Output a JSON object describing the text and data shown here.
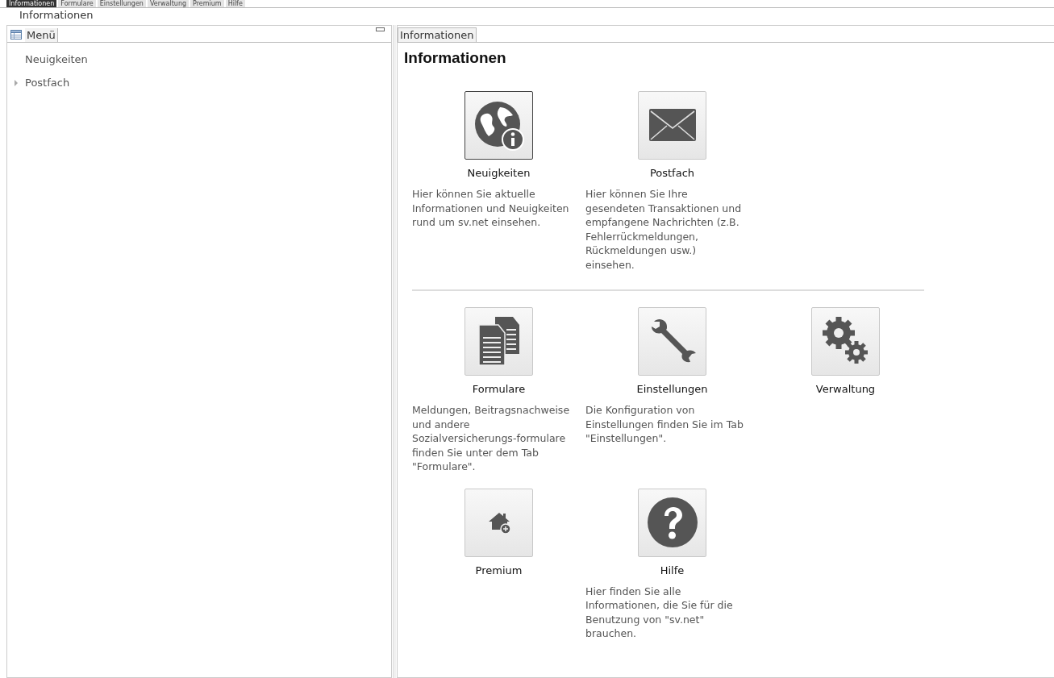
{
  "top_tabs": [
    {
      "label": "Informationen",
      "selected": true
    },
    {
      "label": "Formulare",
      "selected": false
    },
    {
      "label": "Einstellungen",
      "selected": false
    },
    {
      "label": "Verwaltung",
      "selected": false
    },
    {
      "label": "Premium",
      "selected": false
    },
    {
      "label": "Hilfe",
      "selected": false
    }
  ],
  "breadcrumb": "Informationen",
  "sidebar": {
    "tab": "Menü",
    "items": [
      {
        "label": "Neuigkeiten"
      },
      {
        "label": "Postfach",
        "expanded": false
      }
    ]
  },
  "content": {
    "tab": "Informationen",
    "title": "Informationen",
    "sections": [
      {
        "tiles": [
          {
            "kind": "news",
            "label": "Neuigkeiten",
            "selected": true,
            "description": "Hier können Sie aktuelle Informationen und Neuigkeiten rund um sv.net einsehen."
          },
          {
            "kind": "mail",
            "label": "Postfach",
            "selected": false,
            "description": "Hier können Sie Ihre gesendeten Transaktionen und empfangene Nachrichten (z.B. Fehlerrückmeldungen, Rückmeldungen usw.) einsehen."
          }
        ]
      },
      {
        "tiles": [
          {
            "kind": "forms",
            "label": "Formulare",
            "selected": false,
            "description": "Meldungen, Beitragsnachweise und andere Sozialversicherungs-formulare finden Sie unter dem Tab \"Formulare\"."
          },
          {
            "kind": "settings",
            "label": "Einstellungen",
            "selected": false,
            "description": "Die Konfiguration von Einstellungen finden Sie im Tab \"Einstellungen\"."
          },
          {
            "kind": "admin",
            "label": "Verwaltung",
            "selected": false
          },
          {
            "kind": "premium",
            "label": "Premium",
            "selected": false
          },
          {
            "kind": "help",
            "label": "Hilfe",
            "selected": false,
            "description": "Hier finden Sie alle Informationen, die Sie für die Benutzung von \"sv.net\" brauchen."
          }
        ]
      }
    ]
  }
}
